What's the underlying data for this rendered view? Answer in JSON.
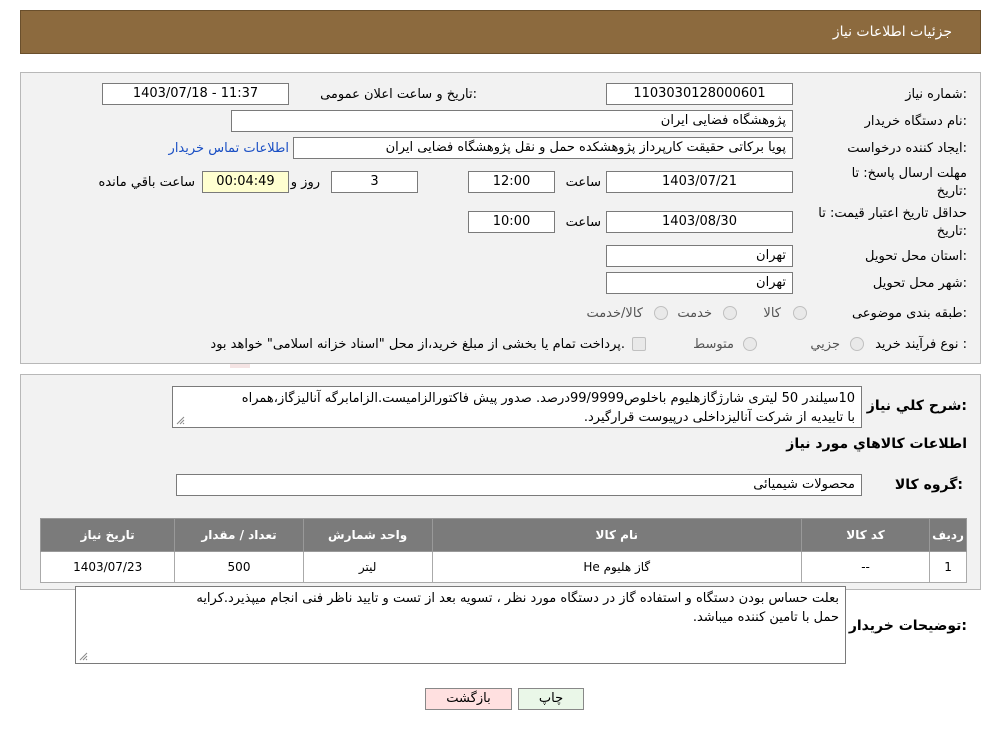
{
  "header": {
    "title": "جزئیات اطلاعات نیاز"
  },
  "form": {
    "need_number_label": "شماره نیاز:",
    "need_number": "1103030128000601",
    "announce_label": "تاریخ و ساعت اعلان عمومی:",
    "announce_value": "1403/07/18 - 11:37",
    "buyer_org_label": "نام دستگاه خریدار:",
    "buyer_org": "پژوهشگاه فضایی ایران",
    "creator_label": "ایجاد کننده درخواست:",
    "creator": "پویا برکاتی حقیقت کارپرداز پژوهشکده حمل و نقل پژوهشگاه فضایی ایران",
    "contact_link": "اطلاعات تماس خریدار",
    "deadline_label_1": "مهلت ارسال پاسخ: تا",
    "deadline_label_2": "تاریخ:",
    "deadline_date": "1403/07/21",
    "time_label": "ساعت",
    "deadline_time": "12:00",
    "days_value": "3",
    "days_label": "روز و",
    "remaining_time": "00:04:49",
    "remaining_label": "ساعت باقي مانده",
    "validity_label_1": "حداقل تاریخ اعتبار قیمت: تا",
    "validity_label_2": "تاریخ:",
    "validity_date": "1403/08/30",
    "validity_time": "10:00",
    "province_label": "استان محل تحویل:",
    "province": "تهران",
    "city_label": "شهر محل تحویل:",
    "city": "تهران",
    "category_label": "طبقه بندی موضوعی:",
    "category_options": [
      "کالا",
      "خدمت",
      "کالا/خدمت"
    ],
    "process_label": "نوع فرآیند خرید :",
    "process_options": [
      "جزیي",
      "متوسط"
    ],
    "process_note": "پرداخت تمام یا بخشی از مبلغ خرید،از محل \"اسناد خزانه اسلامی\" خواهد بود."
  },
  "description": {
    "label": "شرح کلي نياز:",
    "line1": "10سیلندر 50 لیتری شارژگازهلیوم باخلوص99/9999درصد. صدور پیش فاکتورالزامیست.الزامابرگه آنالیزگاز،همراه",
    "line2": "با تاییدیه از شرکت آنالیزداخلی درپیوست قرارگیرد."
  },
  "goods_section": {
    "title": "اطلاعات کالاهاي مورد نياز",
    "group_label": "گروه کالا:",
    "group_value": "محصولات شیمیائی"
  },
  "table": {
    "headers": [
      "رديف",
      "کد کالا",
      "نام کالا",
      "واحد شمارش",
      "تعداد / مقدار",
      "تاریخ نیاز"
    ],
    "rows": [
      {
        "row": "1",
        "code": "--",
        "name": "گاز هلیوم He",
        "unit": "لیتر",
        "qty": "500",
        "date": "1403/07/23"
      }
    ]
  },
  "buyer_notes": {
    "label": "توضیحات خریدار:",
    "line1": "بعلت حساس بودن دستگاه و استفاده گاز در دستگاه مورد نظر ، تسویه بعد از تست و تایید ناظر فنی انجام میپذیرد.کرایه",
    "line2": "حمل با تامین کننده میباشد."
  },
  "buttons": {
    "print": "چاپ",
    "back": "بازگشت"
  },
  "watermark": {
    "text": "AriaTender.neT"
  },
  "colors": {
    "header_bg": "#8c6a3e",
    "panel_bg": "#f2f2f2",
    "table_header": "#7b7b7b",
    "link": "#1a4fc4",
    "back_button": "#ffe0e0",
    "print_button": "#eaf7e8"
  }
}
